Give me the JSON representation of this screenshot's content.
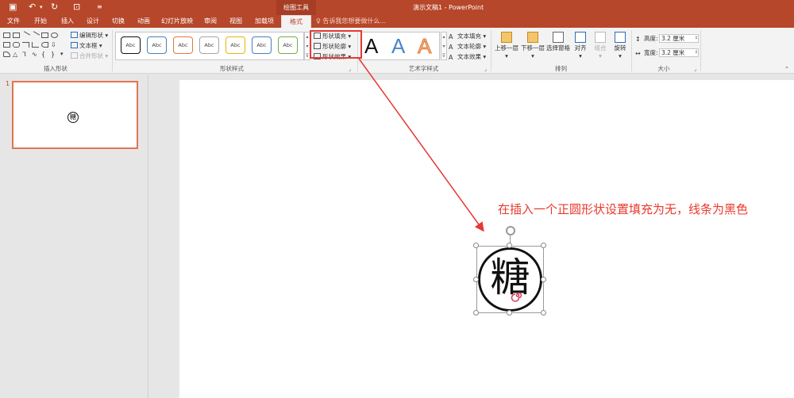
{
  "titlebar": {
    "save_icon": "save-icon",
    "undo_icon": "undo-icon",
    "redo_icon": "redo-icon",
    "present_icon": "present-icon",
    "context_tools": "绘图工具",
    "window_title": "演示文稿1 - PowerPoint",
    "bg": "#b7472a"
  },
  "tabs": [
    {
      "label": "文件"
    },
    {
      "label": "开始"
    },
    {
      "label": "插入"
    },
    {
      "label": "设计"
    },
    {
      "label": "切换"
    },
    {
      "label": "动画"
    },
    {
      "label": "幻灯片放映"
    },
    {
      "label": "审阅"
    },
    {
      "label": "视图"
    },
    {
      "label": "加载项"
    },
    {
      "label": "格式"
    }
  ],
  "search_tip": "告诉我您想要做什么...",
  "ribbon": {
    "insert_shapes": {
      "edit_shape": "编辑形状",
      "textbox": "文本框",
      "merge_shapes": "合并形状",
      "group_label": "插入形状"
    },
    "shape_styles": {
      "samples": [
        "Abc",
        "Abc",
        "Abc",
        "Abc",
        "Abc",
        "Abc",
        "Abc"
      ],
      "fill": "形状填充",
      "outline": "形状轮廓",
      "effects": "形状效果",
      "group_label": "形状样式"
    },
    "wordart": {
      "sample": "A",
      "text_fill": "文本填充",
      "text_outline": "文本轮廓",
      "text_effects": "文本效果",
      "group_label": "艺术字样式"
    },
    "arrange": {
      "bring_forward": "上移一层",
      "send_backward": "下移一层",
      "selection_pane": "选择窗格",
      "align": "对齐",
      "group": "组合",
      "rotate": "旋转",
      "group_label": "排列"
    },
    "size": {
      "height_label": "高度:",
      "height_value": "3.2 厘米",
      "width_label": "宽度:",
      "width_value": "3.2 厘米",
      "group_label": "大小"
    }
  },
  "slides_panel": {
    "slide_number": "1",
    "thumb_glyph": "糖"
  },
  "slide": {
    "glyph": "糖",
    "annotation": "在插入一个正圆形状设置填充为无，线条为黑色",
    "annotation_color": "#e8392b"
  }
}
